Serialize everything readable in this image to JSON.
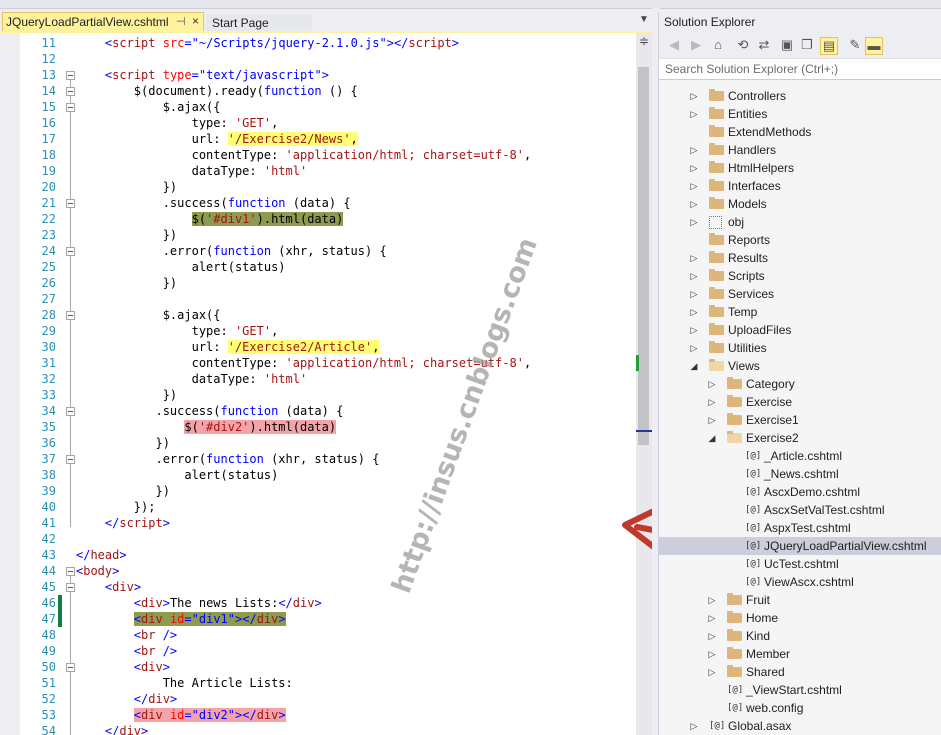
{
  "editor": {
    "active_tab": "JQueryLoadPartialView.cshtml",
    "pin_icon": "⊣",
    "close_icon": "×",
    "inactive_tab": "Start Page",
    "dropdown_icon": "▼",
    "lines": [
      {
        "n": "11",
        "tokens": [
          {
            "t": "    "
          },
          {
            "t": "<",
            "c": "b"
          },
          {
            "t": "script",
            "c": "m"
          },
          {
            "t": " "
          },
          {
            "t": "src",
            "c": "r"
          },
          {
            "t": "=",
            "c": "b"
          },
          {
            "t": "\"~/Scripts/jquery-2.1.0.js\"",
            "c": "b"
          },
          {
            "t": "></",
            "c": "b"
          },
          {
            "t": "script",
            "c": "m"
          },
          {
            "t": ">",
            "c": "b"
          }
        ]
      },
      {
        "n": "12",
        "tokens": []
      },
      {
        "n": "13",
        "fold": true,
        "tokens": [
          {
            "t": "    "
          },
          {
            "t": "<",
            "c": "b"
          },
          {
            "t": "script",
            "c": "m"
          },
          {
            "t": " "
          },
          {
            "t": "type",
            "c": "r"
          },
          {
            "t": "=",
            "c": "b"
          },
          {
            "t": "\"text/javascript\"",
            "c": "b"
          },
          {
            "t": ">",
            "c": "b"
          }
        ]
      },
      {
        "n": "14",
        "fold": true,
        "tokens": [
          {
            "t": "        $(document).ready("
          },
          {
            "t": "function",
            "c": "k"
          },
          {
            "t": " () {"
          }
        ]
      },
      {
        "n": "15",
        "fold": true,
        "tokens": [
          {
            "t": "            $.ajax({"
          }
        ]
      },
      {
        "n": "16",
        "tokens": [
          {
            "t": "                type: "
          },
          {
            "t": "'GET'",
            "c": "s"
          },
          {
            "t": ","
          }
        ]
      },
      {
        "n": "17",
        "tokens": [
          {
            "t": "                url: "
          },
          {
            "t": "'/Exercise2/News'",
            "c": "s",
            "h": "y"
          },
          {
            "t": ",",
            "h": "y"
          }
        ]
      },
      {
        "n": "18",
        "tokens": [
          {
            "t": "                contentType: "
          },
          {
            "t": "'application/html; charset=utf-8'",
            "c": "s"
          },
          {
            "t": ","
          }
        ]
      },
      {
        "n": "19",
        "tokens": [
          {
            "t": "                dataType: "
          },
          {
            "t": "'html'",
            "c": "s"
          }
        ]
      },
      {
        "n": "20",
        "tokens": [
          {
            "t": "            })"
          }
        ]
      },
      {
        "n": "21",
        "fold": true,
        "tokens": [
          {
            "t": "            .success("
          },
          {
            "t": "function",
            "c": "k"
          },
          {
            "t": " (data) {"
          }
        ]
      },
      {
        "n": "22",
        "tokens": [
          {
            "t": "                "
          },
          {
            "t": "$(",
            "h": "o"
          },
          {
            "t": "'#div1'",
            "c": "s",
            "h": "o"
          },
          {
            "t": ").html(data)",
            "h": "o"
          }
        ]
      },
      {
        "n": "23",
        "tokens": [
          {
            "t": "            })"
          }
        ]
      },
      {
        "n": "24",
        "fold": true,
        "tokens": [
          {
            "t": "            .error("
          },
          {
            "t": "function",
            "c": "k"
          },
          {
            "t": " (xhr, status) {"
          }
        ]
      },
      {
        "n": "25",
        "tokens": [
          {
            "t": "                alert(status)"
          }
        ]
      },
      {
        "n": "26",
        "tokens": [
          {
            "t": "            })"
          }
        ]
      },
      {
        "n": "27",
        "tokens": []
      },
      {
        "n": "28",
        "fold": true,
        "tokens": [
          {
            "t": "            $.ajax({"
          }
        ]
      },
      {
        "n": "29",
        "tokens": [
          {
            "t": "                type: "
          },
          {
            "t": "'GET'",
            "c": "s"
          },
          {
            "t": ","
          }
        ]
      },
      {
        "n": "30",
        "tokens": [
          {
            "t": "                url: "
          },
          {
            "t": "'/Exercise2/Article'",
            "c": "s",
            "h": "y"
          },
          {
            "t": ",",
            "h": "y"
          }
        ]
      },
      {
        "n": "31",
        "tokens": [
          {
            "t": "                contentType: "
          },
          {
            "t": "'application/html; charset=utf-8'",
            "c": "s"
          },
          {
            "t": ","
          }
        ]
      },
      {
        "n": "32",
        "tokens": [
          {
            "t": "                dataType: "
          },
          {
            "t": "'html'",
            "c": "s"
          }
        ]
      },
      {
        "n": "33",
        "tokens": [
          {
            "t": "            })"
          }
        ]
      },
      {
        "n": "34",
        "fold": true,
        "tokens": [
          {
            "t": "           .success("
          },
          {
            "t": "function",
            "c": "k"
          },
          {
            "t": " (data) {"
          }
        ]
      },
      {
        "n": "35",
        "tokens": [
          {
            "t": "               "
          },
          {
            "t": "$(",
            "h": "p"
          },
          {
            "t": "'#div2'",
            "c": "s",
            "h": "p"
          },
          {
            "t": ").html(data)",
            "h": "p"
          }
        ]
      },
      {
        "n": "36",
        "tokens": [
          {
            "t": "           })"
          }
        ]
      },
      {
        "n": "37",
        "fold": true,
        "tokens": [
          {
            "t": "           .error("
          },
          {
            "t": "function",
            "c": "k"
          },
          {
            "t": " (xhr, status) {"
          }
        ]
      },
      {
        "n": "38",
        "tokens": [
          {
            "t": "               alert(status)"
          }
        ]
      },
      {
        "n": "39",
        "tokens": [
          {
            "t": "           })"
          }
        ]
      },
      {
        "n": "40",
        "tokens": [
          {
            "t": "        });"
          }
        ]
      },
      {
        "n": "41",
        "tokens": [
          {
            "t": "    "
          },
          {
            "t": "</",
            "c": "b"
          },
          {
            "t": "script",
            "c": "m"
          },
          {
            "t": ">",
            "c": "b"
          }
        ]
      },
      {
        "n": "42",
        "tokens": []
      },
      {
        "n": "43",
        "tokens": [
          {
            "t": "</",
            "c": "b"
          },
          {
            "t": "head",
            "c": "m"
          },
          {
            "t": ">",
            "c": "b"
          }
        ]
      },
      {
        "n": "44",
        "fold": true,
        "tokens": [
          {
            "t": "<",
            "c": "b"
          },
          {
            "t": "body",
            "c": "m"
          },
          {
            "t": ">",
            "c": "b"
          }
        ]
      },
      {
        "n": "45",
        "fold": true,
        "tokens": [
          {
            "t": "    "
          },
          {
            "t": "<",
            "c": "b"
          },
          {
            "t": "div",
            "c": "m"
          },
          {
            "t": ">",
            "c": "b"
          }
        ]
      },
      {
        "n": "46",
        "changed": true,
        "tokens": [
          {
            "t": "        "
          },
          {
            "t": "<",
            "c": "b"
          },
          {
            "t": "div",
            "c": "m"
          },
          {
            "t": ">",
            "c": "b"
          },
          {
            "t": "The news Lists:"
          },
          {
            "t": "</",
            "c": "b"
          },
          {
            "t": "div",
            "c": "m"
          },
          {
            "t": ">",
            "c": "b"
          }
        ]
      },
      {
        "n": "47",
        "changed": true,
        "tokens": [
          {
            "t": "        "
          },
          {
            "t": "<",
            "c": "b",
            "h": "o"
          },
          {
            "t": "div",
            "c": "m",
            "h": "o"
          },
          {
            "t": " ",
            "h": "o"
          },
          {
            "t": "id",
            "c": "r",
            "h": "o"
          },
          {
            "t": "=",
            "c": "b",
            "h": "o"
          },
          {
            "t": "\"div1\"",
            "c": "b",
            "h": "o"
          },
          {
            "t": "></",
            "c": "b",
            "h": "o"
          },
          {
            "t": "div",
            "c": "m",
            "h": "o"
          },
          {
            "t": ">",
            "c": "b",
            "h": "o"
          }
        ]
      },
      {
        "n": "48",
        "tokens": [
          {
            "t": "        "
          },
          {
            "t": "<",
            "c": "b"
          },
          {
            "t": "br",
            "c": "m"
          },
          {
            "t": " />",
            "c": "b"
          }
        ]
      },
      {
        "n": "49",
        "tokens": [
          {
            "t": "        "
          },
          {
            "t": "<",
            "c": "b"
          },
          {
            "t": "br",
            "c": "m"
          },
          {
            "t": " />",
            "c": "b"
          }
        ]
      },
      {
        "n": "50",
        "fold": true,
        "tokens": [
          {
            "t": "        "
          },
          {
            "t": "<",
            "c": "b"
          },
          {
            "t": "div",
            "c": "m"
          },
          {
            "t": ">",
            "c": "b"
          }
        ]
      },
      {
        "n": "51",
        "tokens": [
          {
            "t": "            The Article Lists:"
          }
        ]
      },
      {
        "n": "52",
        "tokens": [
          {
            "t": "        "
          },
          {
            "t": "</",
            "c": "b"
          },
          {
            "t": "div",
            "c": "m"
          },
          {
            "t": ">",
            "c": "b"
          }
        ]
      },
      {
        "n": "53",
        "tokens": [
          {
            "t": "        "
          },
          {
            "t": "<",
            "c": "b",
            "h": "p"
          },
          {
            "t": "div",
            "c": "m",
            "h": "p"
          },
          {
            "t": " ",
            "h": "p"
          },
          {
            "t": "id",
            "c": "r",
            "h": "p"
          },
          {
            "t": "=",
            "c": "b",
            "h": "p"
          },
          {
            "t": "\"div2\"",
            "c": "b",
            "h": "p"
          },
          {
            "t": "></",
            "c": "b",
            "h": "p"
          },
          {
            "t": "div",
            "c": "m",
            "h": "p"
          },
          {
            "t": ">",
            "c": "b",
            "h": "p"
          }
        ]
      },
      {
        "n": "54",
        "tokens": [
          {
            "t": "    "
          },
          {
            "t": "</",
            "c": "b"
          },
          {
            "t": "div",
            "c": "m"
          },
          {
            "t": ">",
            "c": "b"
          }
        ]
      }
    ]
  },
  "watermark": "http://insus.cnblogs.com",
  "solution_explorer": {
    "title": "Solution Explorer",
    "search_placeholder": "Search Solution Explorer (Ctrl+;)",
    "toolbar": [
      {
        "icon": "back-icon",
        "glyph": "◀",
        "dim": true
      },
      {
        "icon": "forward-icon",
        "glyph": "▶",
        "dim": true
      },
      {
        "icon": "home-icon",
        "glyph": "⌂"
      },
      {
        "icon": "history-icon",
        "glyph": "⟲"
      },
      {
        "icon": "sync-icon",
        "glyph": "⇄"
      },
      {
        "icon": "collapse-icon",
        "glyph": "▣"
      },
      {
        "icon": "copy-icon",
        "glyph": "❐"
      },
      {
        "icon": "show-files-icon",
        "glyph": "▤",
        "active": true
      },
      {
        "icon": "properties-icon",
        "glyph": "✎"
      },
      {
        "icon": "pin-icon",
        "glyph": "▬",
        "active": true
      }
    ],
    "items": [
      {
        "label": "Controllers",
        "depth": 0,
        "exp": "▷",
        "type": "folder"
      },
      {
        "label": "Entities",
        "depth": 0,
        "exp": "▷",
        "type": "folder"
      },
      {
        "label": "ExtendMethods",
        "depth": 0,
        "exp": "",
        "type": "folder"
      },
      {
        "label": "Handlers",
        "depth": 0,
        "exp": "▷",
        "type": "folder"
      },
      {
        "label": "HtmlHelpers",
        "depth": 0,
        "exp": "▷",
        "type": "folder"
      },
      {
        "label": "Interfaces",
        "depth": 0,
        "exp": "▷",
        "type": "folder"
      },
      {
        "label": "Models",
        "depth": 0,
        "exp": "▷",
        "type": "folder"
      },
      {
        "label": "obj",
        "depth": 0,
        "exp": "▷",
        "type": "dotted"
      },
      {
        "label": "Reports",
        "depth": 0,
        "exp": "",
        "type": "folder"
      },
      {
        "label": "Results",
        "depth": 0,
        "exp": "▷",
        "type": "folder"
      },
      {
        "label": "Scripts",
        "depth": 0,
        "exp": "▷",
        "type": "folder"
      },
      {
        "label": "Services",
        "depth": 0,
        "exp": "▷",
        "type": "folder"
      },
      {
        "label": "Temp",
        "depth": 0,
        "exp": "▷",
        "type": "folder"
      },
      {
        "label": "UploadFiles",
        "depth": 0,
        "exp": "▷",
        "type": "folder"
      },
      {
        "label": "Utilities",
        "depth": 0,
        "exp": "▷",
        "type": "folder"
      },
      {
        "label": "Views",
        "depth": 0,
        "exp": "◢",
        "type": "folder-open"
      },
      {
        "label": "Category",
        "depth": 1,
        "exp": "▷",
        "type": "folder"
      },
      {
        "label": "Exercise",
        "depth": 1,
        "exp": "▷",
        "type": "folder"
      },
      {
        "label": "Exercise1",
        "depth": 1,
        "exp": "▷",
        "type": "folder"
      },
      {
        "label": "Exercise2",
        "depth": 1,
        "exp": "◢",
        "type": "folder-open"
      },
      {
        "label": "_Article.cshtml",
        "depth": 2,
        "exp": "",
        "type": "file"
      },
      {
        "label": "_News.cshtml",
        "depth": 2,
        "exp": "",
        "type": "file"
      },
      {
        "label": "AscxDemo.cshtml",
        "depth": 2,
        "exp": "",
        "type": "file"
      },
      {
        "label": "AscxSetValTest.cshtml",
        "depth": 2,
        "exp": "",
        "type": "file"
      },
      {
        "label": "AspxTest.cshtml",
        "depth": 2,
        "exp": "",
        "type": "file"
      },
      {
        "label": "JQueryLoadPartialView.cshtml",
        "depth": 2,
        "exp": "",
        "type": "file",
        "selected": true
      },
      {
        "label": "UcTest.cshtml",
        "depth": 2,
        "exp": "",
        "type": "file"
      },
      {
        "label": "ViewAscx.cshtml",
        "depth": 2,
        "exp": "",
        "type": "file"
      },
      {
        "label": "Fruit",
        "depth": 1,
        "exp": "▷",
        "type": "folder"
      },
      {
        "label": "Home",
        "depth": 1,
        "exp": "▷",
        "type": "folder"
      },
      {
        "label": "Kind",
        "depth": 1,
        "exp": "▷",
        "type": "folder"
      },
      {
        "label": "Member",
        "depth": 1,
        "exp": "▷",
        "type": "folder"
      },
      {
        "label": "Shared",
        "depth": 1,
        "exp": "▷",
        "type": "folder"
      },
      {
        "label": "_ViewStart.cshtml",
        "depth": 1,
        "exp": "",
        "type": "file"
      },
      {
        "label": "web.config",
        "depth": 1,
        "exp": "",
        "type": "config"
      },
      {
        "label": "Global.asax",
        "depth": 0,
        "exp": "▷",
        "type": "asax"
      }
    ],
    "file_glyph": "[@]"
  },
  "colors": {
    "highlight_yellow": "#ffff00",
    "highlight_olive": "#8d9b4f",
    "highlight_pink": "#f4a3a8",
    "arrow": "#c0392b",
    "tab_active": "#fff29d"
  }
}
